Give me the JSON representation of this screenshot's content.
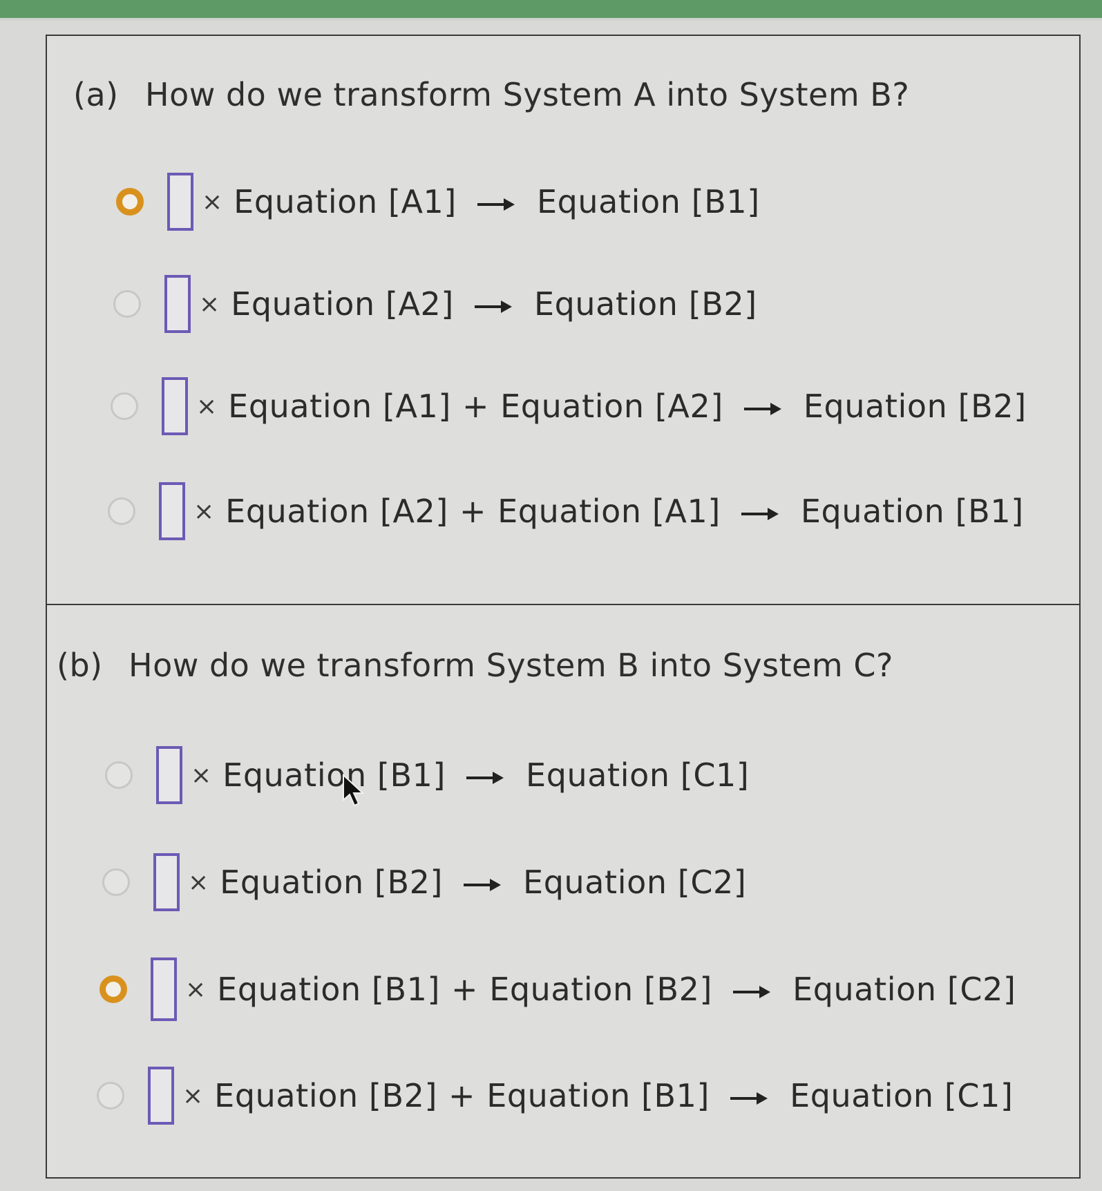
{
  "questions": [
    {
      "label": "(a)",
      "text": "How do we transform System A into System B?",
      "options": [
        {
          "selected": true,
          "times": "×",
          "terms": [
            "Equation [A1]"
          ],
          "plus": "",
          "result": "Equation [B1]"
        },
        {
          "selected": false,
          "times": "×",
          "terms": [
            "Equation [A2]"
          ],
          "plus": "",
          "result": "Equation [B2]"
        },
        {
          "selected": false,
          "times": "×",
          "terms": [
            "Equation [A1]",
            "Equation [A2]"
          ],
          "plus": "+",
          "result": "Equation [B2]"
        },
        {
          "selected": false,
          "times": "×",
          "terms": [
            "Equation [A2]",
            "Equation [A1]"
          ],
          "plus": "+",
          "result": "Equation [B1]"
        }
      ]
    },
    {
      "label": "(b)",
      "text": "How do we transform System B into System C?",
      "options": [
        {
          "selected": false,
          "times": "×",
          "terms": [
            "Equation [B1]"
          ],
          "plus": "",
          "result": "Equation [C1]"
        },
        {
          "selected": false,
          "times": "×",
          "terms": [
            "Equation [B2]"
          ],
          "plus": "",
          "result": "Equation [C2]"
        },
        {
          "selected": true,
          "times": "×",
          "terms": [
            "Equation [B1]",
            "Equation [B2]"
          ],
          "plus": "+",
          "result": "Equation [C2]"
        },
        {
          "selected": false,
          "times": "×",
          "terms": [
            "Equation [B2]",
            "Equation [B1]"
          ],
          "plus": "+",
          "result": "Equation [C1]"
        }
      ]
    }
  ],
  "colors": {
    "radio_selected": "#d9911e",
    "coefficient_box_border": "#6c5ab5",
    "top_strip": "#5e9a66"
  },
  "icons": {
    "arrow": "right-arrow-icon",
    "cursor": "mouse-cursor-icon"
  }
}
